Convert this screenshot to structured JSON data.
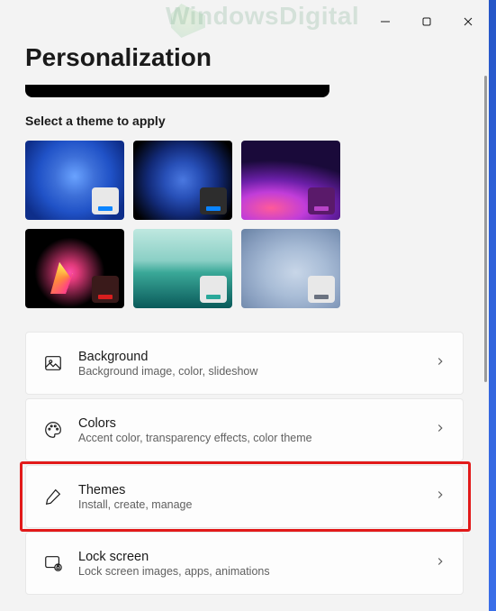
{
  "watermark": "WindowsDigital",
  "page": {
    "title": "Personalization",
    "theme_section_label": "Select a theme to apply"
  },
  "themes": [
    {
      "name": "windows-light",
      "accent": "#0a84ff"
    },
    {
      "name": "windows-dark",
      "accent": "#0a84ff"
    },
    {
      "name": "glow",
      "accent": "#b844c8"
    },
    {
      "name": "captured-motion",
      "accent": "#d81e1e"
    },
    {
      "name": "sunrise",
      "accent": "#2aa89a"
    },
    {
      "name": "flow",
      "accent": "#6a7280"
    }
  ],
  "settings": [
    {
      "key": "background",
      "title": "Background",
      "sub": "Background image, color, slideshow"
    },
    {
      "key": "colors",
      "title": "Colors",
      "sub": "Accent color, transparency effects, color theme"
    },
    {
      "key": "themes",
      "title": "Themes",
      "sub": "Install, create, manage",
      "highlighted": true
    },
    {
      "key": "lock-screen",
      "title": "Lock screen",
      "sub": "Lock screen images, apps, animations"
    }
  ]
}
